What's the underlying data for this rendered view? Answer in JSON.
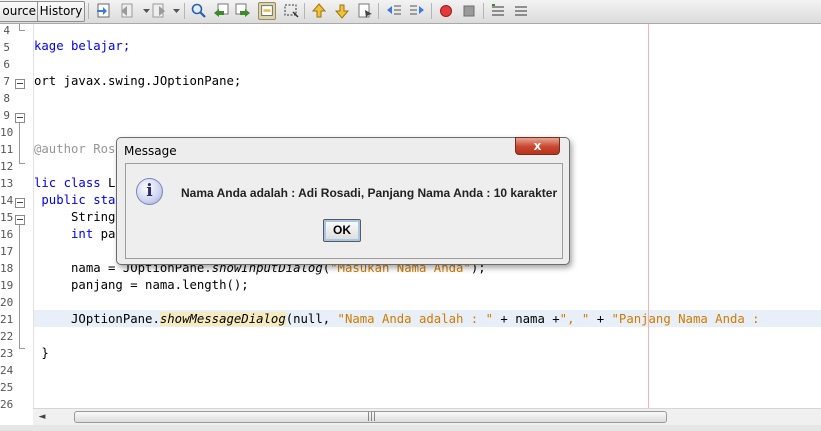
{
  "toolbar": {
    "source_label": "ource",
    "history_label": "History"
  },
  "editor": {
    "line_numbers": [
      "4",
      "5",
      "6",
      "7",
      "8",
      "9",
      "10",
      "11",
      "12",
      "13",
      "14",
      "15",
      "16",
      "17",
      "18",
      "19",
      "20",
      "21",
      "22",
      "23",
      "24",
      "25",
      "26"
    ],
    "lines": {
      "l4": "",
      "l5": "kage belajar;",
      "l7": "ort javax.swing.JOptionPane;",
      "l11": "@author Ros",
      "l13a": "lic class ",
      "l13b": "L",
      "l14a": " public stat",
      "l15": "     String",
      "l16a": "     int",
      "l16b": " pa",
      "l18a": "     nama = JOptionPane.",
      "l18b": "showInputDialog",
      "l18c": "(",
      "l18d": "\"Masukan Nama Anda\"",
      "l18e": ");",
      "l19": "     panjang = nama.length();",
      "l21a": "     JOptionPane.",
      "l21b": "showMessageDialog",
      "l21c": "(null, ",
      "l21d": "\"Nama Anda adalah : \"",
      "l21e": " + nama +",
      "l21f": "\", \"",
      "l21g": " + ",
      "l21h": "\"Panjang Nama Anda : ",
      "l23": " }"
    }
  },
  "dialog": {
    "title": "Message",
    "close_glyph": "x",
    "message": "Nama Anda adalah : Adi Rosadi, Panjang Nama Anda : 10 karakter",
    "ok_label": "OK",
    "info_glyph": "i"
  },
  "scrollbar": {
    "left_arrow": "◄",
    "grip": "|||"
  },
  "colors": {
    "keyword": "#0000e6",
    "string": "#ce7b00",
    "comment": "#969696",
    "current_line": "#e9eff8",
    "margin_line": "#f2b3b3"
  }
}
